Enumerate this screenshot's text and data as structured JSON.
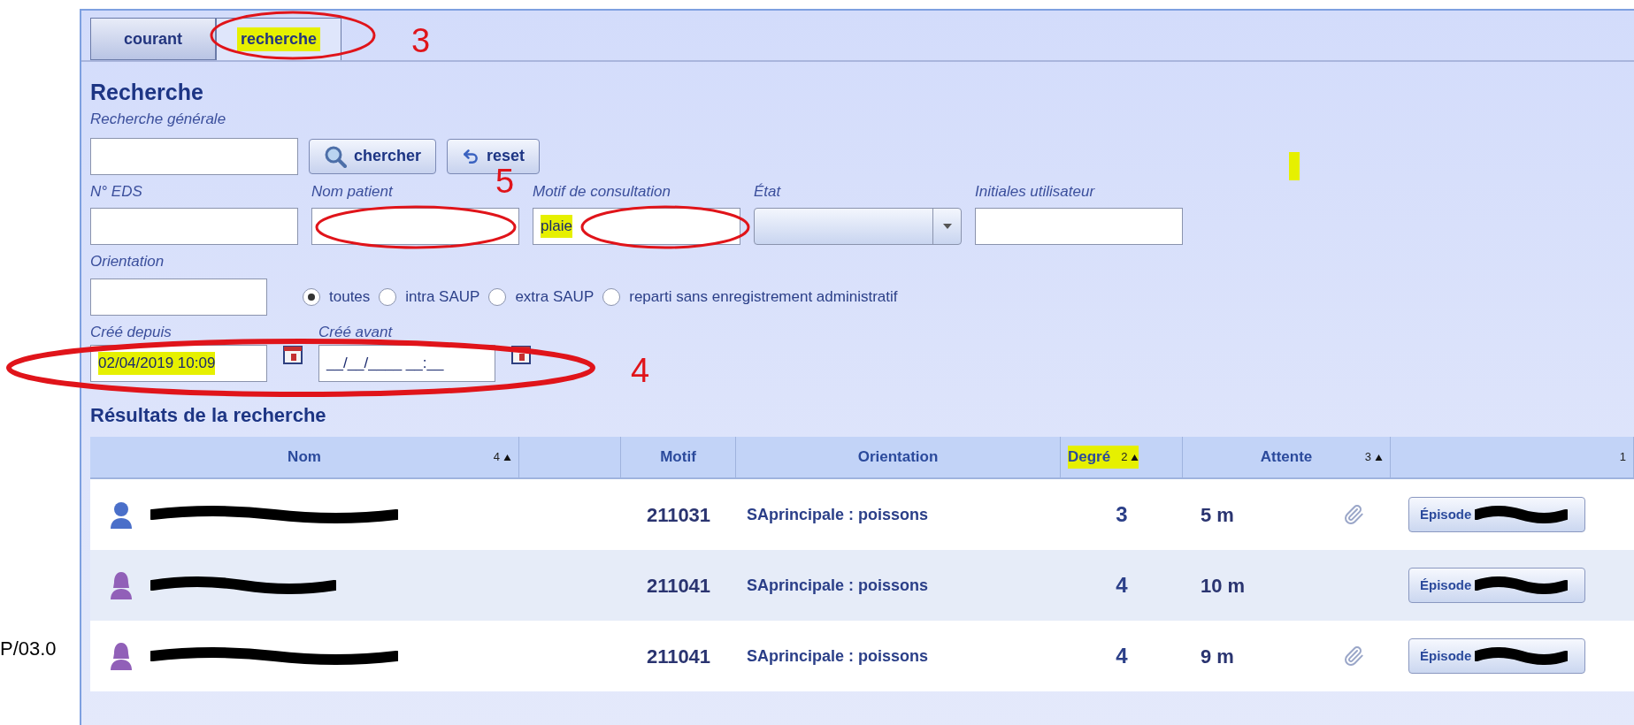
{
  "tabs": [
    {
      "label": "courant",
      "selected": false,
      "highlighted": false
    },
    {
      "label": "recherche",
      "selected": true,
      "highlighted": true
    }
  ],
  "heading": "Recherche",
  "general_search": {
    "label": "Recherche générale"
  },
  "buttons": [
    {
      "label": "chercher",
      "kind": "search"
    },
    {
      "label": "reset",
      "kind": "reset"
    }
  ],
  "fields": [
    {
      "label": "N° EDS",
      "kind": "text"
    },
    {
      "label": "Nom patient",
      "kind": "text"
    },
    {
      "label": "Motif de consultation",
      "kind": "text",
      "value": "plaie",
      "highlighted": true
    },
    {
      "label": "État",
      "kind": "select"
    },
    {
      "label": "Initiales utilisateur",
      "kind": "text"
    }
  ],
  "orientation": {
    "label": "Orientation",
    "options": [
      {
        "label": "toutes",
        "selected": true
      },
      {
        "label": "intra SAUP",
        "selected": false
      },
      {
        "label": "extra SAUP",
        "selected": false
      },
      {
        "label": "reparti sans enregistrement administratif",
        "selected": false
      }
    ]
  },
  "date_fields": [
    {
      "label": "Créé depuis",
      "value": "02/04/2019 10:09",
      "highlighted": true
    },
    {
      "label": "Créé avant",
      "value": "__/__/____ __:__",
      "highlighted": false
    }
  ],
  "results": {
    "title": "Résultats de la recherche",
    "columns": [
      {
        "label": "Nom",
        "sort_rank": "4",
        "highlighted": false
      },
      {},
      {
        "label": "Motif",
        "highlighted": false
      },
      {
        "label": "Orientation",
        "highlighted": false
      },
      {
        "label": "Degré",
        "sort_rank": "2",
        "highlighted": true
      },
      {
        "label": "Attente",
        "sort_rank": "3",
        "highlighted": false
      },
      {
        "sort_rank": "1"
      }
    ],
    "rows": [
      {
        "kind": "male",
        "motif": "211031",
        "orientation": "SAprincipale : poissons",
        "degre": "3",
        "attente": "5 m",
        "attachment": true,
        "episode": "Épisode"
      },
      {
        "kind": "female",
        "motif": "211041",
        "orientation": "SAprincipale : poissons",
        "degre": "4",
        "attente": "10 m",
        "attachment": false,
        "episode": "Épisode"
      },
      {
        "kind": "female",
        "motif": "211041",
        "orientation": "SAprincipale : poissons",
        "degre": "4",
        "attente": "9 m",
        "attachment": true,
        "episode": "Épisode"
      }
    ]
  },
  "annotations": [
    {
      "label": "3"
    },
    {
      "label": "5"
    },
    {
      "label": "4"
    }
  ],
  "slide_footer": "P/03.0"
}
